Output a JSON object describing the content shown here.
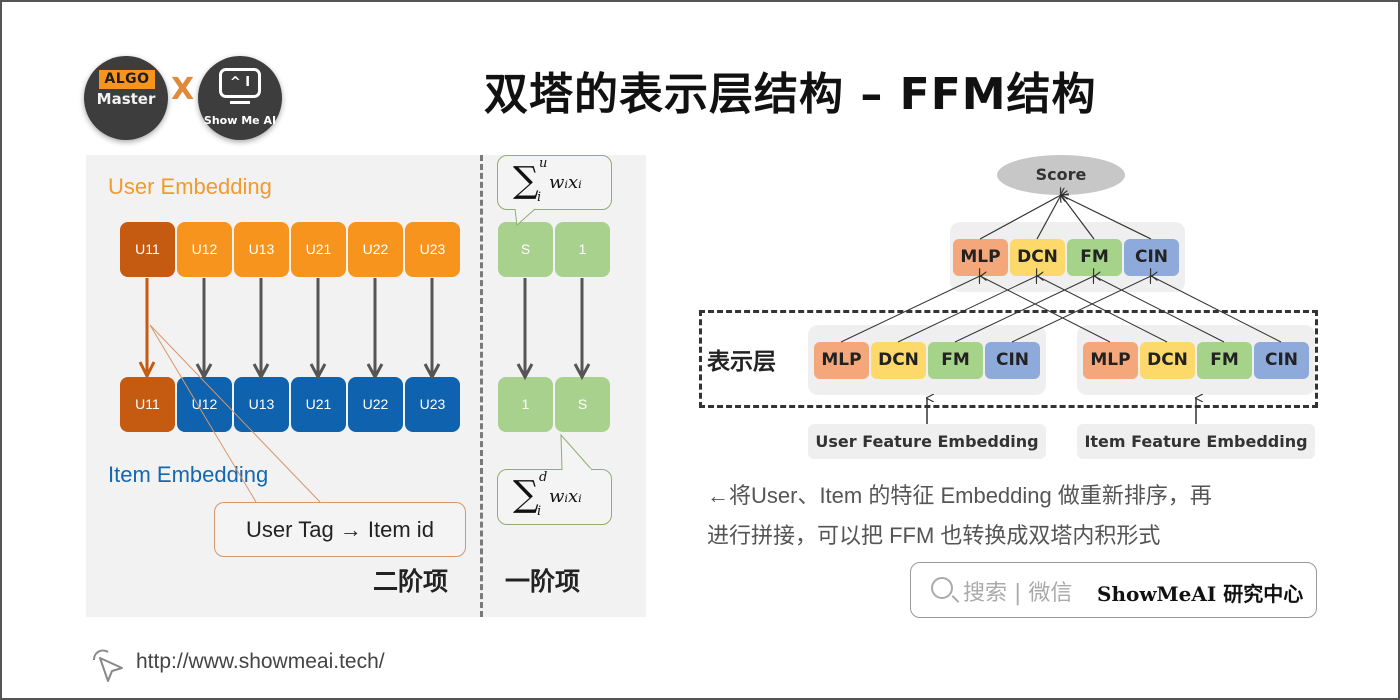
{
  "title": "双塔的表示层结构 – FFM结构",
  "logos": {
    "algo_tag": "ALGO",
    "algo_sub": "Master",
    "x_left": "\\",
    "x_right": "/",
    "showme_glyph": "^ I",
    "showme_sub": "Show Me AI"
  },
  "left_panel": {
    "user_label": "User Embedding",
    "item_label": "Item Embedding",
    "user_cells": [
      "U11",
      "U12",
      "U13",
      "U21",
      "U22",
      "U23"
    ],
    "item_cells": [
      "U11",
      "U12",
      "U13",
      "U21",
      "U22",
      "U23"
    ],
    "first_order_top": [
      "S",
      "1"
    ],
    "first_order_bottom": [
      "1",
      "S"
    ],
    "formula_top": {
      "sigma": "∑",
      "sup": "u",
      "sub": "i",
      "body": "wᵢxᵢ"
    },
    "formula_bottom": {
      "sigma": "∑",
      "sup": "d",
      "sub": "i",
      "body": "wᵢxᵢ"
    },
    "callout": "User Tag → Item id",
    "second_order_label": "二阶项",
    "first_order_label": "一阶项"
  },
  "right_diagram": {
    "score": "Score",
    "top_blocks": [
      "MLP",
      "DCN",
      "FM",
      "CIN"
    ],
    "layer_label": "表示层",
    "user_blocks": [
      "MLP",
      "DCN",
      "FM",
      "CIN"
    ],
    "item_blocks": [
      "MLP",
      "DCN",
      "FM",
      "CIN"
    ],
    "user_embedding": "User Feature Embedding",
    "item_embedding": "Item Feature Embedding"
  },
  "description": {
    "line1": "←将User、Item 的特征 Embedding 做重新排序，再",
    "line2": "进行拼接，可以把 FFM 也转换成双塔内积形式"
  },
  "search_box": {
    "hint": "搜索 | 微信",
    "brand": "ShowMeAI 研究中心"
  },
  "footer": {
    "url": "http://www.showmeai.tech/"
  },
  "colors": {
    "user_orange": "#f7941d",
    "user_dark_orange": "#c55a11",
    "item_blue": "#0f62ad",
    "first_order_green": "#a9d18e",
    "mlp": "#f4a77b",
    "dcn": "#fdd96b",
    "fm": "#a6d38a",
    "cin": "#8eaadb"
  }
}
